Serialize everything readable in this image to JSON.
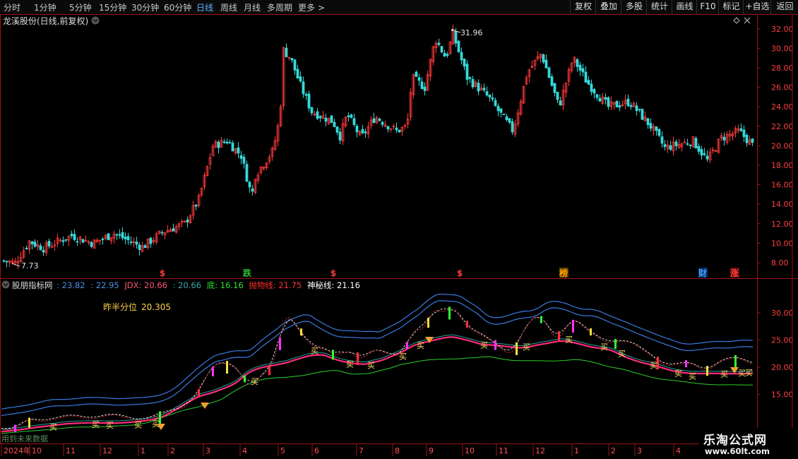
{
  "toolbar": {
    "periods": [
      "分时",
      "1分钟",
      "5分钟",
      "15分钟",
      "30分钟",
      "60分钟",
      "日线",
      "周线",
      "月线",
      "多周期",
      "更多"
    ],
    "active_period": "日线",
    "more_arrow": ">",
    "right_buttons": [
      "复权",
      "叠加",
      "多股",
      "统计",
      "画线",
      "F10",
      "标记",
      "+自选",
      "返回"
    ]
  },
  "main": {
    "title": "龙溪股份(日线,前复权)",
    "expand_icon": "chevron-down-icon",
    "diamond_icon": "diamond-icon",
    "close_icon": "close-icon",
    "price_axis": [
      "32.00",
      "30.00",
      "28.00",
      "26.00",
      "24.00",
      "22.00",
      "20.00",
      "18.00",
      "16.00",
      "14.00",
      "12.00",
      "10.00",
      "8.00"
    ],
    "high_label": "31.96",
    "low_label": "7.73",
    "event_markers": [
      {
        "label": "$",
        "color": "#ff3b3b"
      },
      {
        "label": "跌",
        "color": "#30c030"
      },
      {
        "label": "$",
        "color": "#ff3b3b"
      },
      {
        "label": "$",
        "color": "#ff3b3b"
      },
      {
        "label": "榜",
        "color": "#ffa000"
      },
      {
        "label": "财",
        "color": "#40a0ff"
      },
      {
        "label": "涨",
        "color": "#ff4040"
      }
    ]
  },
  "indicator": {
    "name": "股朋指标网",
    "values": [
      {
        "text": ": 23.82",
        "color": "#4a90e2"
      },
      {
        "text": ": 22.95",
        "color": "#4a90e2"
      },
      {
        "text": "JDX: 20.66",
        "color": "#ff5577"
      },
      {
        "text": ": 20.66",
        "color": "#3aa8a8"
      },
      {
        "text": "底: 16.16",
        "color": "#30e030"
      },
      {
        "text": "抛物线: 21.75",
        "color": "#ff3030"
      },
      {
        "text": "神秘线: 21.16",
        "color": "#ffffff"
      }
    ],
    "annotation_label": "昨半分位",
    "annotation_value": "20.305",
    "axis": [
      "30.00",
      "25.00",
      "20.00",
      "15.00"
    ],
    "buy_label": "买",
    "future_data_note": "用到未来数据"
  },
  "time_axis": {
    "labels": [
      "2024年",
      "10",
      "11",
      "12",
      "1",
      "2",
      "3",
      "4",
      "5",
      "6",
      "7",
      "8",
      "9",
      "10",
      "11",
      "12",
      "1",
      "2",
      "3",
      "4"
    ]
  },
  "watermark": {
    "line1": "乐淘公式网",
    "line2": "www.60lt.com"
  },
  "colors": {
    "up": "#ff3b3b",
    "down": "#35d8d8",
    "frame": "#9a1414",
    "bg": "#000000"
  }
}
